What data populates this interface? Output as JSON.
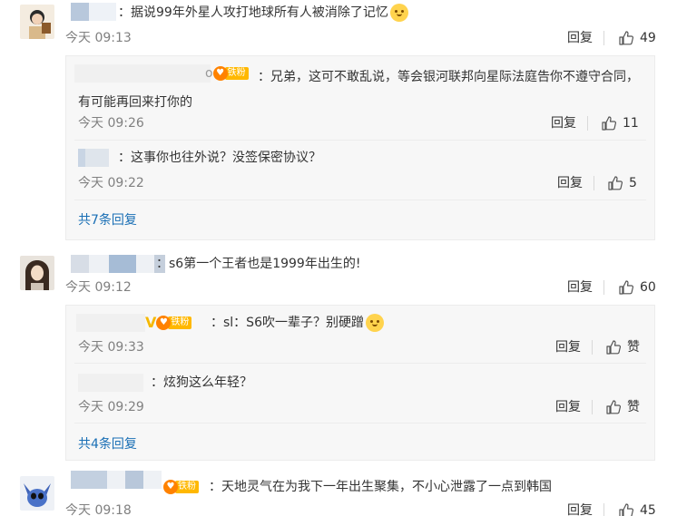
{
  "comments": [
    {
      "text": "：据说99年外星人攻打地球所有人被消除了记忆",
      "time": "今天 09:13",
      "reply_label": "回复",
      "likes": "49",
      "replies": [
        {
          "name_tail": "o",
          "badge": "铁粉",
          "text": "：兄弟，这可不敢乱说，等会银河联邦向星际法庭告你不遵守合同，有可能再回来打你的",
          "time": "今天 09:26",
          "reply_label": "回复",
          "likes": "11"
        },
        {
          "text": "：这事你也往外说？没签保密协议？",
          "time": "今天 09:22",
          "reply_label": "回复",
          "likes": "5"
        }
      ],
      "more": "共7条回复"
    },
    {
      "text": "：s6第一个王者也是1999年出生的!",
      "time": "今天 09:12",
      "reply_label": "回复",
      "likes": "60",
      "replies": [
        {
          "badge": "铁粉",
          "text": "：sl：S6吹一辈子？别硬蹭",
          "time": "今天 09:33",
          "reply_label": "回复",
          "likes": "赞"
        },
        {
          "text": "：炫狗这么年轻？",
          "time": "今天 09:29",
          "reply_label": "回复",
          "likes": "赞"
        }
      ],
      "more": "共4条回复"
    },
    {
      "badge": "铁粉",
      "text": "：天地灵气在为我下一年出生聚集，不小心泄露了一点到韩国",
      "time": "今天 09:18",
      "reply_label": "回复",
      "likes": "45"
    }
  ]
}
